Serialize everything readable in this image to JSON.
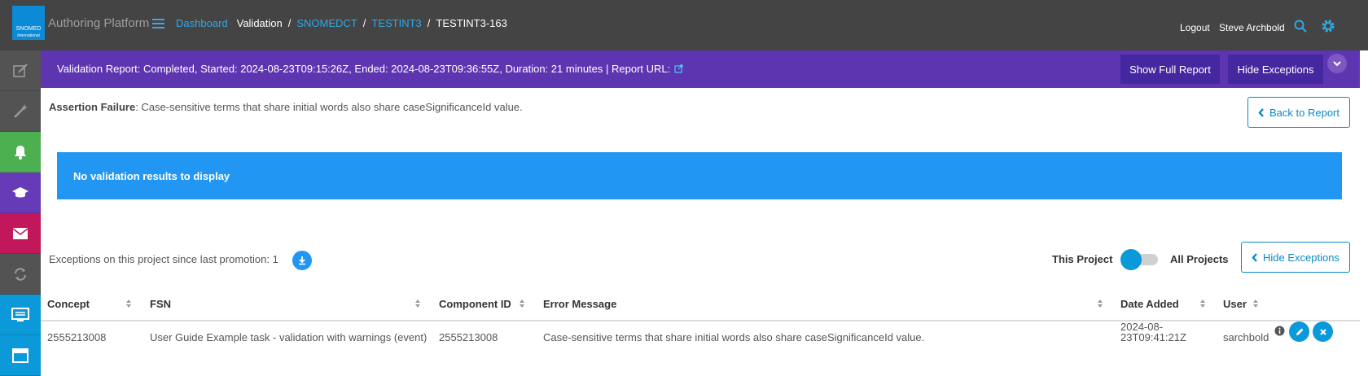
{
  "header": {
    "logo_text": "SNOMED",
    "logo_sub": "International",
    "app_title": "Authoring Platform",
    "breadcrumb": {
      "dashboard": "Dashboard",
      "validation": "Validation",
      "codesystem": "SNOMEDCT",
      "project": "TESTINT3",
      "task": "TESTINT3-163"
    },
    "logout": "Logout",
    "username": "Steve Archbold",
    "icons": [
      "menu-icon",
      "search-icon",
      "gear-icon"
    ]
  },
  "sidebar": {
    "items": [
      {
        "icon": "edit-icon",
        "color": "#535353"
      },
      {
        "icon": "magic-wand-icon",
        "color": "#535353"
      },
      {
        "icon": "bell-icon",
        "color": "#4caf50"
      },
      {
        "icon": "graduation-cap-icon",
        "color": "#673ab7"
      },
      {
        "icon": "envelope-icon",
        "color": "#c2185b"
      },
      {
        "icon": "sync-icon",
        "color": "#535353"
      },
      {
        "icon": "monitor-icon",
        "color": "#0b99d9"
      },
      {
        "icon": "browser-icon",
        "color": "#0b99d9"
      }
    ]
  },
  "banner": {
    "text": "Validation Report: Completed, Started: 2024-08-23T09:15:26Z, Ended: 2024-08-23T09:36:55Z, Duration: 21 minutes | Report URL:",
    "show_full_report": "Show Full Report",
    "hide_exceptions": "Hide Exceptions",
    "color": "#5e35b1"
  },
  "assertion": {
    "label": "Assertion Failure",
    "text": ": Case-sensitive terms that share initial words also share caseSignificanceId value."
  },
  "back_button": "Back to Report",
  "no_results": "No validation results to display",
  "exceptions": {
    "summary": "Exceptions on this project since last promotion: 1",
    "toggle_left": "This Project",
    "toggle_right": "All Projects",
    "hide_button": "Hide Exceptions"
  },
  "table": {
    "headers": {
      "concept": "Concept",
      "fsn": "FSN",
      "component_id": "Component ID",
      "error_message": "Error Message",
      "date_added": "Date Added",
      "user": "User"
    },
    "rows": [
      {
        "concept": "2555213008",
        "fsn": "User Guide Example task - validation with warnings (event)",
        "component_id": "2555213008",
        "error_message": "Case-sensitive terms that share initial words also share caseSignificanceId value.",
        "date_added": "2024-08-23T09:41:21Z",
        "user": "sarchbold"
      }
    ]
  }
}
